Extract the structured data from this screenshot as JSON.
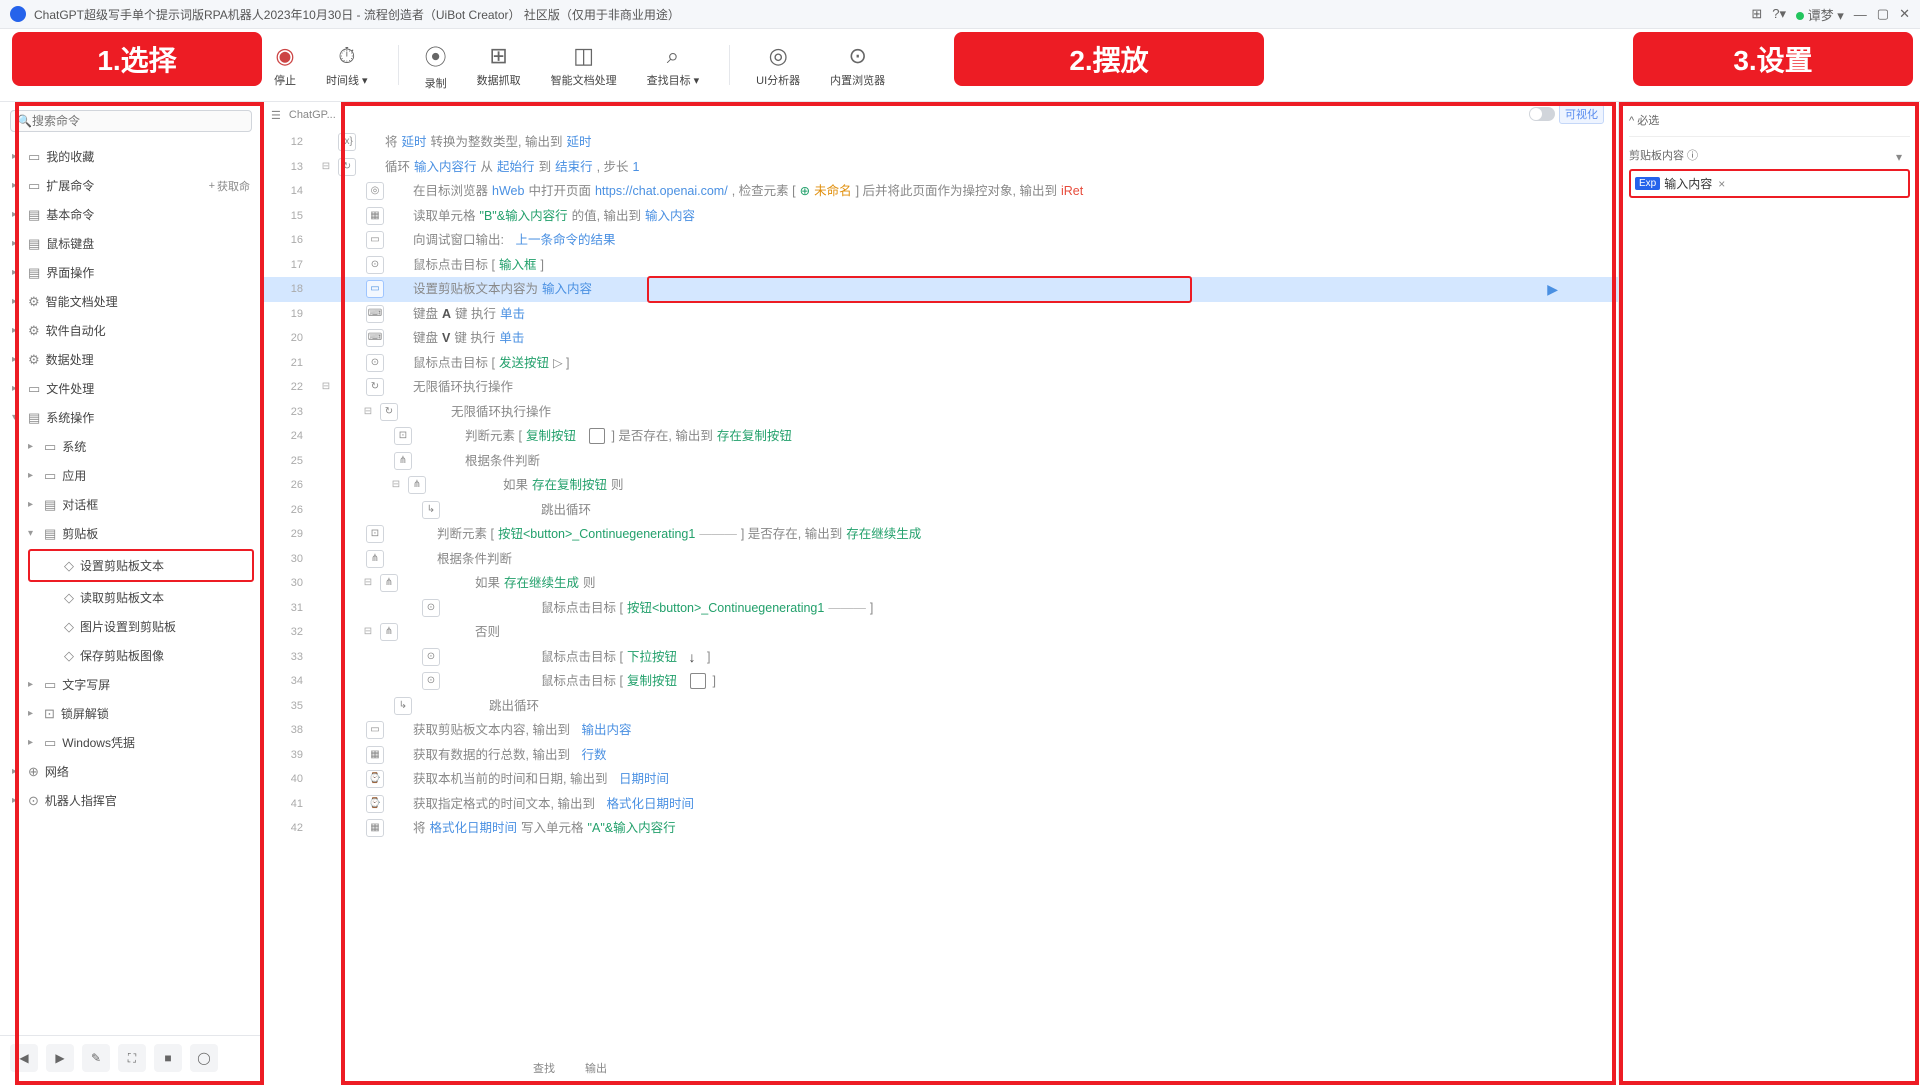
{
  "title": "ChatGPT超级写手单个提示词版RPA机器人2023年10月30日 - 流程创造者（UiBot Creator）  社区版（仅用于非商业用途）",
  "user": "谭梦",
  "annot": {
    "a1": "1.选择",
    "a2": "2.摆放",
    "a3": "3.设置"
  },
  "toolbar": {
    "stop": "停止",
    "time": "时间线",
    "rec": "录制",
    "datacap": "数据抓取",
    "smartdoc": "智能文档处理",
    "findtgt": "查找目标",
    "uian": "UI分析器",
    "browser": "内置浏览器"
  },
  "search_ph": "搜索命令",
  "extract": "获取命",
  "tree": {
    "fav": "我的收藏",
    "ext": "扩展命令",
    "basic": "基本命令",
    "mk": "鼠标键盘",
    "ui": "界面操作",
    "doc": "智能文档处理",
    "auto": "软件自动化",
    "data": "数据处理",
    "file": "文件处理",
    "sys": "系统操作",
    "sys_sys": "系统",
    "sys_app": "应用",
    "sys_dlg": "对话框",
    "sys_clip": "剪贴板",
    "clip_set": "设置剪贴板文本",
    "clip_get": "读取剪贴板文本",
    "clip_img": "图片设置到剪贴板",
    "clip_save": "保存剪贴板图像",
    "sys_text": "文字写屏",
    "sys_lock": "锁屏解锁",
    "sys_win": "Windows凭据",
    "net": "网络",
    "robot": "机器人指挥官"
  },
  "vis": "可视化",
  "tab": "ChatGP...",
  "props": {
    "hdr": "必选",
    "lbl": "剪贴板内容",
    "chip": "输入内容"
  },
  "lines": {
    "l12": {
      "t1": "将",
      "v1": "延时",
      "t2": "转换为整数类型, 输出到",
      "v2": "延时"
    },
    "l13": {
      "t1": "循环",
      "v1": "输入内容行",
      "t2": "从",
      "v2": "起始行",
      "t3": "到",
      "v3": "结束行",
      "t4": ", 步长",
      "n": "1"
    },
    "l14": {
      "t1": "在目标浏览器",
      "v1": "hWeb",
      "t2": "中打开页面",
      "url": "https://chat.openai.com/",
      "t3": ", 检查元素 [",
      "ic": "⊕",
      "nm": "未命名",
      "t4": "] 后并将此页面作为操控对象, 输出到",
      "out": "iRet"
    },
    "l15": {
      "t1": "读取单元格",
      "v1": "\"B\"&输入内容行",
      "t2": "的值, 输出到",
      "out": "输入内容"
    },
    "l16": {
      "t1": "向调试窗口输出:",
      "v": "上一条命令的结果"
    },
    "l17": {
      "t1": "鼠标点击目标 [",
      "v": "输入框",
      "t2": "       ]"
    },
    "l18": {
      "t1": "设置剪贴板文本内容为",
      "v": "输入内容"
    },
    "l19": {
      "t1": "键盘",
      "k": "A",
      "t2": "键 执行",
      "a": "单击"
    },
    "l20": {
      "t1": "键盘",
      "k": "V",
      "t2": "键 执行",
      "a": "单击"
    },
    "l21": {
      "t1": "鼠标点击目标 [",
      "v": "发送按钮",
      "t2": "   ▷    ]"
    },
    "l22": {
      "t1": "无限循环执行操作"
    },
    "l23": {
      "t1": "无限循环执行操作"
    },
    "l24": {
      "t1": "判断元素 [",
      "v": "复制按钮",
      "t2": "] 是否存在, 输出到",
      "out": "存在复制按钮"
    },
    "l25": {
      "t1": "根据条件判断"
    },
    "l26": {
      "t1": "如果",
      "v": "存在复制按钮",
      "t2": " 则"
    },
    "l27": {
      "t1": "跳出循环"
    },
    "l29": {
      "t1": "判断元素 [",
      "v": "按钮<button>_Continuegenerating1",
      "t2": "] 是否存在, 输出到",
      "out": "存在继续生成"
    },
    "l30a": {
      "t1": "根据条件判断"
    },
    "l30": {
      "t1": "如果",
      "v": "存在继续生成",
      "t2": " 则"
    },
    "l31": {
      "t1": "鼠标点击目标 [",
      "v": "按钮<button>_Continuegenerating1",
      "t2": "       ]"
    },
    "l32": {
      "t1": "否则"
    },
    "l33": {
      "t1": "鼠标点击目标 [",
      "v": "下拉按钮",
      "t2": "]"
    },
    "l34": {
      "t1": "鼠标点击目标 [",
      "v": "复制按钮",
      "t2": "]"
    },
    "l35": {
      "t1": "跳出循环"
    },
    "l38": {
      "t1": "获取剪贴板文本内容, 输出到",
      "v": "输出内容"
    },
    "l39": {
      "t1": "获取有数据的行总数, 输出到",
      "v": "行数"
    },
    "l40": {
      "t1": "获取本机当前的时间和日期, 输出到",
      "v": "日期时间"
    },
    "l41": {
      "t1": "获取指定格式的时间文本, 输出到",
      "v": "格式化日期时间"
    },
    "l42": {
      "t1": "将",
      "v1": "格式化日期时间",
      "t2": "写入单元格",
      "v2": "\"A\"&输入内容行"
    }
  },
  "status": {
    "find": "查找",
    "out": "输出"
  }
}
